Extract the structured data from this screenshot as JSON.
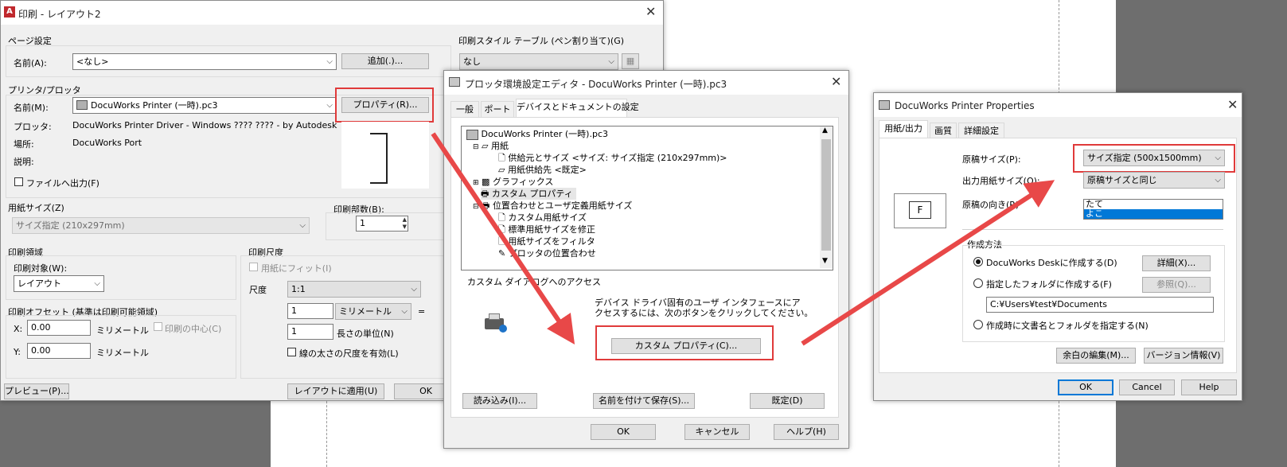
{
  "plot": {
    "title": "印刷 - レイアウト2",
    "page_setup": {
      "group": "ページ設定",
      "name_label": "名前(A):",
      "name_value": "<なし>",
      "add_button": "追加(.)..."
    },
    "printer": {
      "group": "プリンタ/プロッタ",
      "name_label": "名前(M):",
      "name_value": "DocuWorks Printer (一時).pc3",
      "properties_button": "プロパティ(R)...",
      "plotter_label": "プロッタ:",
      "plotter_value": "DocuWorks Printer Driver - Windows ???? ???? - by Autodesk",
      "location_label": "場所:",
      "location_value": "DocuWorks Port",
      "desc_label": "説明:",
      "file_output": "ファイルへ出力(F)"
    },
    "style_table": {
      "group": "印刷スタイル テーブル (ペン割り当て)(G)",
      "value": "なし"
    },
    "paper_size": {
      "group": "用紙サイズ(Z)",
      "value": "サイズ指定 (210x297mm)"
    },
    "copies": {
      "label": "印刷部数(B):",
      "value": "1"
    },
    "area": {
      "group": "印刷領域",
      "target_label": "印刷対象(W):",
      "target_value": "レイアウト"
    },
    "scale": {
      "group": "印刷尺度",
      "fit": "用紙にフィット(I)",
      "scale_label": "尺度",
      "scale_value": "1:1",
      "val1": "1",
      "unit_value": "ミリメートル",
      "equals": "=",
      "val2": "1",
      "unit_label": "長さの単位(N)",
      "lineweight": "線の太さの尺度を有効(L)"
    },
    "offset": {
      "group": "印刷オフセット (基準は印刷可能領域)",
      "x_label": "X:",
      "x_value": "0.00",
      "x_unit": "ミリメートル",
      "center": "印刷の中心(C)",
      "y_label": "Y:",
      "y_value": "0.00",
      "y_unit": "ミリメートル"
    },
    "buttons": {
      "preview": "プレビュー(P)...",
      "apply": "レイアウトに適用(U)",
      "ok": "OK"
    }
  },
  "editor": {
    "title": "プロッタ環境設定エディタ - DocuWorks Printer (一時).pc3",
    "tabs": [
      "一般",
      "ポート",
      "デバイスとドキュメントの設定"
    ],
    "tree": [
      "DocuWorks Printer (一時).pc3",
      "用紙",
      "供給元とサイズ <サイズ: サイズ指定 (210x297mm)>",
      "用紙供給先 <既定>",
      "グラフィックス",
      "カスタム プロパティ",
      "位置合わせとユーザ定義用紙サイズ",
      "カスタム用紙サイズ",
      "標準用紙サイズを修正",
      "用紙サイズをフィルタ",
      "プロッタの位置合わせ"
    ],
    "custom_group": "カスタム ダイアログへのアクセス",
    "custom_desc1": "デバイス ドライバ固有のユーザ インタフェースにア",
    "custom_desc2": "クセスするには、次のボタンをクリックしてください。",
    "custom_button": "カスタム プロパティ(C)...",
    "import_button": "読み込み(I)...",
    "saveas_button": "名前を付けて保存(S)...",
    "default_button": "既定(D)",
    "ok": "OK",
    "cancel": "キャンセル",
    "help": "ヘルプ(H)"
  },
  "props": {
    "title": "DocuWorks Printer Properties",
    "tabs": [
      "用紙/出力",
      "画質",
      "詳細設定"
    ],
    "orig_size_label": "原稿サイズ(P):",
    "orig_size_value": "サイズ指定 (500x1500mm)",
    "out_size_label": "出力用紙サイズ(O):",
    "out_size_value": "原稿サイズと同じ",
    "orientation_label": "原稿の向き(R)",
    "orientation_options": [
      "たて",
      "よこ"
    ],
    "preview_letter": "F",
    "method_group": "作成方法",
    "opt1": "DocuWorks Deskに作成する(D)",
    "detail_button": "詳細(X)...",
    "opt2": "指定したフォルダに作成する(F)",
    "browse_button": "参照(Q)...",
    "path_value": "C:¥Users¥test¥Documents",
    "opt3": "作成時に文書名とフォルダを指定する(N)",
    "margin_button": "余白の編集(M)...",
    "version_button": "バージョン情報(V)",
    "ok": "OK",
    "cancel": "Cancel",
    "help": "Help"
  },
  "colors": {
    "highlight": "#e03a3a",
    "selection": "#0078d7"
  }
}
